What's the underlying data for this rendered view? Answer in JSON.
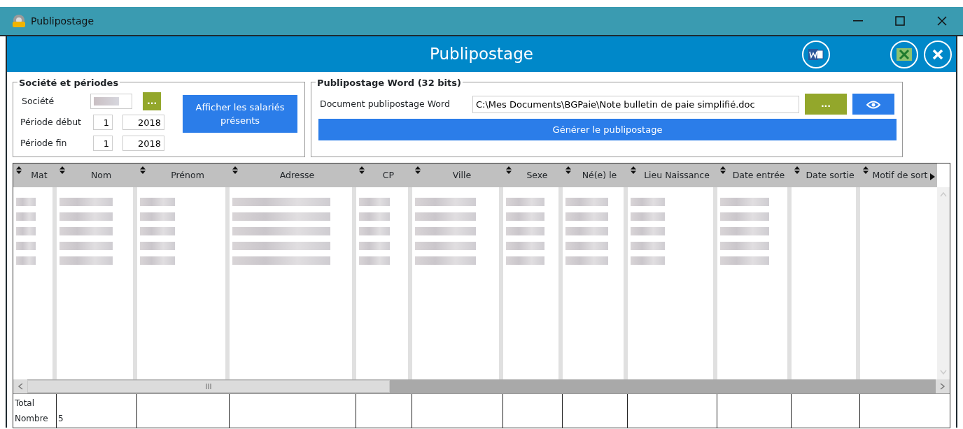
{
  "window": {
    "title": "Publipostage"
  },
  "header": {
    "title": "Publipostage"
  },
  "company_group": {
    "title": "Société et périodes",
    "company_label": "Société",
    "start_label": "Période début",
    "start_month": "1",
    "start_year": "2018",
    "end_label": "Période fin",
    "end_month": "1",
    "end_year": "2018",
    "browse_button": "...",
    "show_button": "Afficher les salariés présents"
  },
  "word_group": {
    "title": "Publipostage Word (32 bits)",
    "document_label": "Document publipostage Word",
    "document_path": "C:\\Mes Documents\\BGPaie\\Note bulletin de paie simplifié.doc",
    "browse_button": "...",
    "generate_button": "Générer le publipostage"
  },
  "table": {
    "columns": [
      {
        "label": "Mat"
      },
      {
        "label": "Nom"
      },
      {
        "label": "Prénom"
      },
      {
        "label": "Adresse"
      },
      {
        "label": "CP"
      },
      {
        "label": "Ville"
      },
      {
        "label": "Sexe"
      },
      {
        "label": "Né(e) le"
      },
      {
        "label": "Lieu Naissance"
      },
      {
        "label": "Date entrée"
      },
      {
        "label": "Date sortie"
      },
      {
        "label": "Motif de sort"
      }
    ],
    "footer": {
      "total_label": "Total",
      "count_label": "Nombre",
      "count": "5"
    }
  }
}
